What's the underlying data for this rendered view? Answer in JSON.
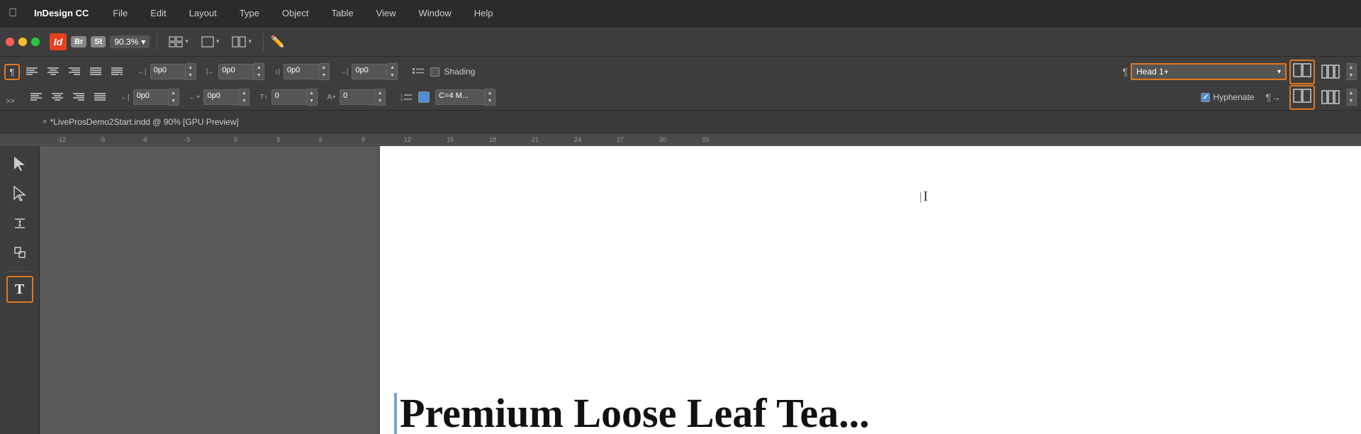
{
  "app": {
    "name": "InDesign CC",
    "apple_symbol": "",
    "id_label": "Id"
  },
  "menu": {
    "items": [
      "File",
      "Edit",
      "Layout",
      "Type",
      "Object",
      "Table",
      "View",
      "Window",
      "Help"
    ]
  },
  "toolbar": {
    "zoom": "90.3%",
    "br_badge": "Br",
    "st_badge": "St",
    "traffic_lights": [
      "red",
      "yellow",
      "green"
    ]
  },
  "para_toolbar": {
    "paragraph_symbol": "¶",
    "align_icons": [
      "left",
      "center",
      "right",
      "justify",
      "justify-all"
    ],
    "align_icons2": [
      "left",
      "center",
      "right",
      "justify"
    ],
    "row1_inputs": [
      "0p0",
      "0p0",
      "0p0",
      "0p0"
    ],
    "row2_inputs": [
      "0p0",
      "0p0",
      "0",
      "0"
    ],
    "shading_label": "Shading",
    "style_name": "Head 1+",
    "hyphenate_label": "Hyphenate",
    "hyphenate_checked": true
  },
  "tab": {
    "close_symbol": "×",
    "label": "*LiveProsDemo2Start.indd @ 90% [GPU Preview]"
  },
  "ruler": {
    "marks": [
      "-12",
      "-9",
      "-6",
      "-3",
      "0",
      "3",
      "6",
      "9",
      "12",
      "15",
      "18",
      "21",
      "24",
      "27",
      "30",
      "33"
    ]
  },
  "left_tools": {
    "icons": [
      "▶",
      "▶",
      "↗",
      "↔",
      "↕",
      "T"
    ]
  },
  "canvas": {
    "cursor_symbol": "I",
    "heading_text": "Premium Loose Leaf Tea..."
  },
  "colors": {
    "orange_highlight": "#e07820",
    "blue_border": "#7a9fd4"
  }
}
